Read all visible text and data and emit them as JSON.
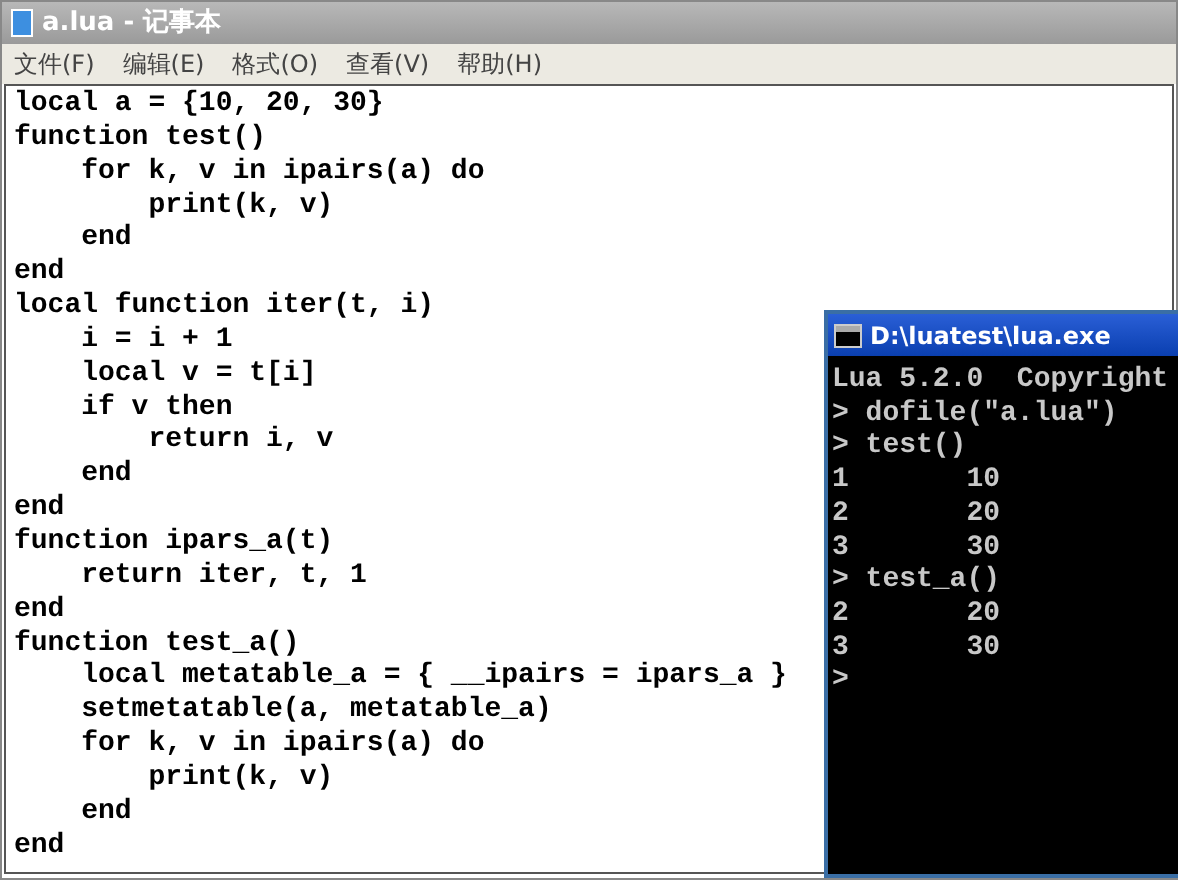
{
  "window": {
    "title": "a.lua - 记事本"
  },
  "menu": [
    "文件(F)",
    "编辑(E)",
    "格式(O)",
    "查看(V)",
    "帮助(H)"
  ],
  "editor": {
    "lines": [
      "local a = {10, 20, 30}",
      "function test()",
      "    for k, v in ipairs(a) do",
      "        print(k, v)",
      "    end",
      "end",
      "local function iter(t, i)",
      "    i = i + 1",
      "    local v = t[i]",
      "    if v then",
      "        return i, v",
      "    end",
      "end",
      "function ipars_a(t)",
      "    return iter, t, 1",
      "end",
      "function test_a()",
      "    local metatable_a = { __ipairs = ipars_a }",
      "    setmetatable(a, metatable_a)",
      "    for k, v in ipairs(a) do",
      "        print(k, v)",
      "    end",
      "end"
    ]
  },
  "console": {
    "title": "D:\\luatest\\lua.exe",
    "lines": [
      "Lua 5.2.0  Copyright",
      "> dofile(\"a.lua\")",
      "> test()",
      "1       10",
      "2       20",
      "3       30",
      "> test_a()",
      "2       20",
      "3       30",
      ">"
    ]
  }
}
